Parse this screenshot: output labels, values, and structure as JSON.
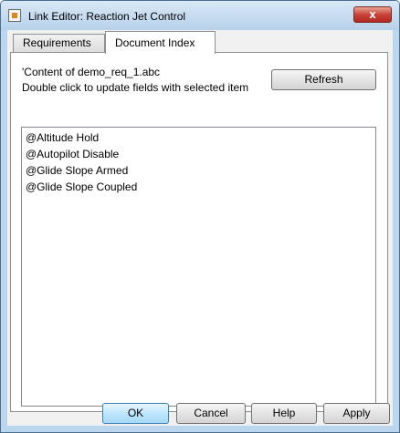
{
  "window": {
    "title": "Link Editor: Reaction Jet Control",
    "close_label": "x"
  },
  "tabs": [
    {
      "label": "Requirements",
      "active": false
    },
    {
      "label": "Document Index",
      "active": true
    }
  ],
  "document_index": {
    "content_line": "'Content of demo_req_1.abc",
    "hint_line": "Double click to update fields with selected item",
    "refresh_label": "Refresh",
    "items": [
      "@Altitude Hold",
      "@Autopilot Disable",
      "@Glide Slope Armed",
      "@Glide Slope Coupled"
    ]
  },
  "footer": {
    "ok_label": "OK",
    "cancel_label": "Cancel",
    "help_label": "Help",
    "apply_label": "Apply"
  }
}
